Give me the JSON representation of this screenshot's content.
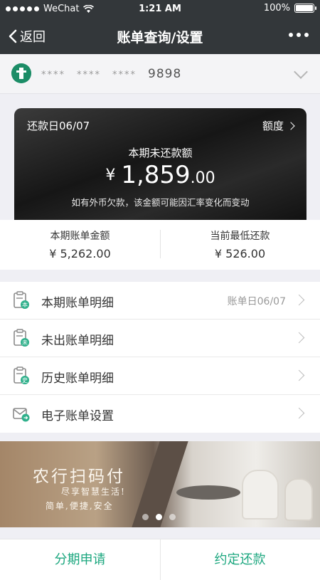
{
  "status_bar": {
    "carrier": "WeChat",
    "time": "1:21 AM",
    "battery": "100%"
  },
  "nav": {
    "back_label": "返回",
    "title": "账单查询/设置"
  },
  "card": {
    "masked": [
      "****",
      "****",
      "****"
    ],
    "last4": "9898"
  },
  "bill": {
    "due_date_label": "还款日06/07",
    "quota_label": "额度",
    "unpaid_label": "本期未还款额",
    "currency": "¥",
    "amount_int": "1,859",
    "amount_dec": ".00",
    "note": "如有外币欠款，该金额可能因汇率变化而变动"
  },
  "summary": {
    "statement_label": "本期账单金额",
    "statement_value": "¥ 5,262.00",
    "min_label": "当前最低还款",
    "min_value": "¥ 526.00"
  },
  "menu": [
    {
      "label": "本期账单明细",
      "extra": "账单日06/07",
      "icon": "current-bill-icon",
      "badge": "本"
    },
    {
      "label": "未出账单明细",
      "extra": "",
      "icon": "unbilled-icon",
      "badge": "未"
    },
    {
      "label": "历史账单明细",
      "extra": "",
      "icon": "history-bill-icon",
      "badge": "史"
    },
    {
      "label": "电子账单设置",
      "extra": "",
      "icon": "email-bill-icon",
      "badge": ""
    }
  ],
  "banner": {
    "title": "农行扫码付",
    "subtitle": "尽享智慧生活!",
    "tagline": "简单,便捷,安全",
    "active_slide": 2,
    "slides": 3
  },
  "bottom": {
    "left_label": "分期申请",
    "right_label": "约定还款"
  },
  "colors": {
    "nav_bg": "#33373a",
    "accent": "#1ca77f",
    "bank_green": "#1c8d67"
  }
}
